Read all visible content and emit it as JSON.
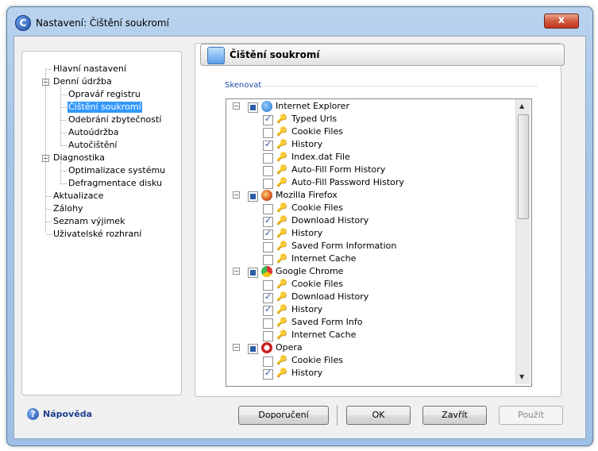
{
  "window": {
    "title": "Nastavení: Čištění soukromí",
    "close_glyph": "x"
  },
  "nav": {
    "items": [
      {
        "label": "Hlavní nastavení"
      },
      {
        "label": "Denní údržba"
      },
      {
        "label": "Opravář registru"
      },
      {
        "label": "Čištění soukromí"
      },
      {
        "label": "Odebrání zbytečností"
      },
      {
        "label": "Autoúdržba"
      },
      {
        "label": "Autočištění"
      },
      {
        "label": "Diagnostika"
      },
      {
        "label": "Optimalizace systému"
      },
      {
        "label": "Defragmentace disku"
      },
      {
        "label": "Aktualizace"
      },
      {
        "label": "Zálohy"
      },
      {
        "label": "Seznam výjimek"
      },
      {
        "label": "Uživatelské rozhraní"
      }
    ],
    "selected": "Čištění soukromí"
  },
  "panel": {
    "title": "Čištění soukromí",
    "group_label": "Skenovat"
  },
  "scan_list": {
    "groups": [
      {
        "name": "Internet Explorer",
        "icon": "internet-explorer-icon",
        "items": [
          {
            "label": "Typed Urls",
            "checked": true
          },
          {
            "label": "Cookie Files",
            "checked": false
          },
          {
            "label": "History",
            "checked": true
          },
          {
            "label": "Index.dat File",
            "checked": false
          },
          {
            "label": "Auto-Fill Form History",
            "checked": false
          },
          {
            "label": "Auto-Fill Password History",
            "checked": false
          }
        ]
      },
      {
        "name": "Mozilla Firefox",
        "icon": "firefox-icon",
        "items": [
          {
            "label": "Cookie Files",
            "checked": false
          },
          {
            "label": "Download History",
            "checked": true
          },
          {
            "label": "History",
            "checked": true
          },
          {
            "label": "Saved Form Information",
            "checked": false
          },
          {
            "label": "Internet Cache",
            "checked": false
          }
        ]
      },
      {
        "name": "Google Chrome",
        "icon": "chrome-icon",
        "items": [
          {
            "label": "Cookie Files",
            "checked": false
          },
          {
            "label": "Download History",
            "checked": true
          },
          {
            "label": "History",
            "checked": true
          },
          {
            "label": "Saved Form Info",
            "checked": false
          },
          {
            "label": "Internet Cache",
            "checked": false
          }
        ]
      },
      {
        "name": "Opera",
        "icon": "opera-icon",
        "items": [
          {
            "label": "Cookie Files",
            "checked": false
          },
          {
            "label": "History",
            "checked": true
          }
        ]
      }
    ]
  },
  "footer": {
    "help_label": "Nápověda",
    "recommend_label": "Doporučení",
    "ok_label": "OK",
    "close_label": "Zavřít",
    "apply_label": "Použít"
  },
  "colors": {
    "selection": "#3399ff",
    "check": "#2a4f9e"
  }
}
